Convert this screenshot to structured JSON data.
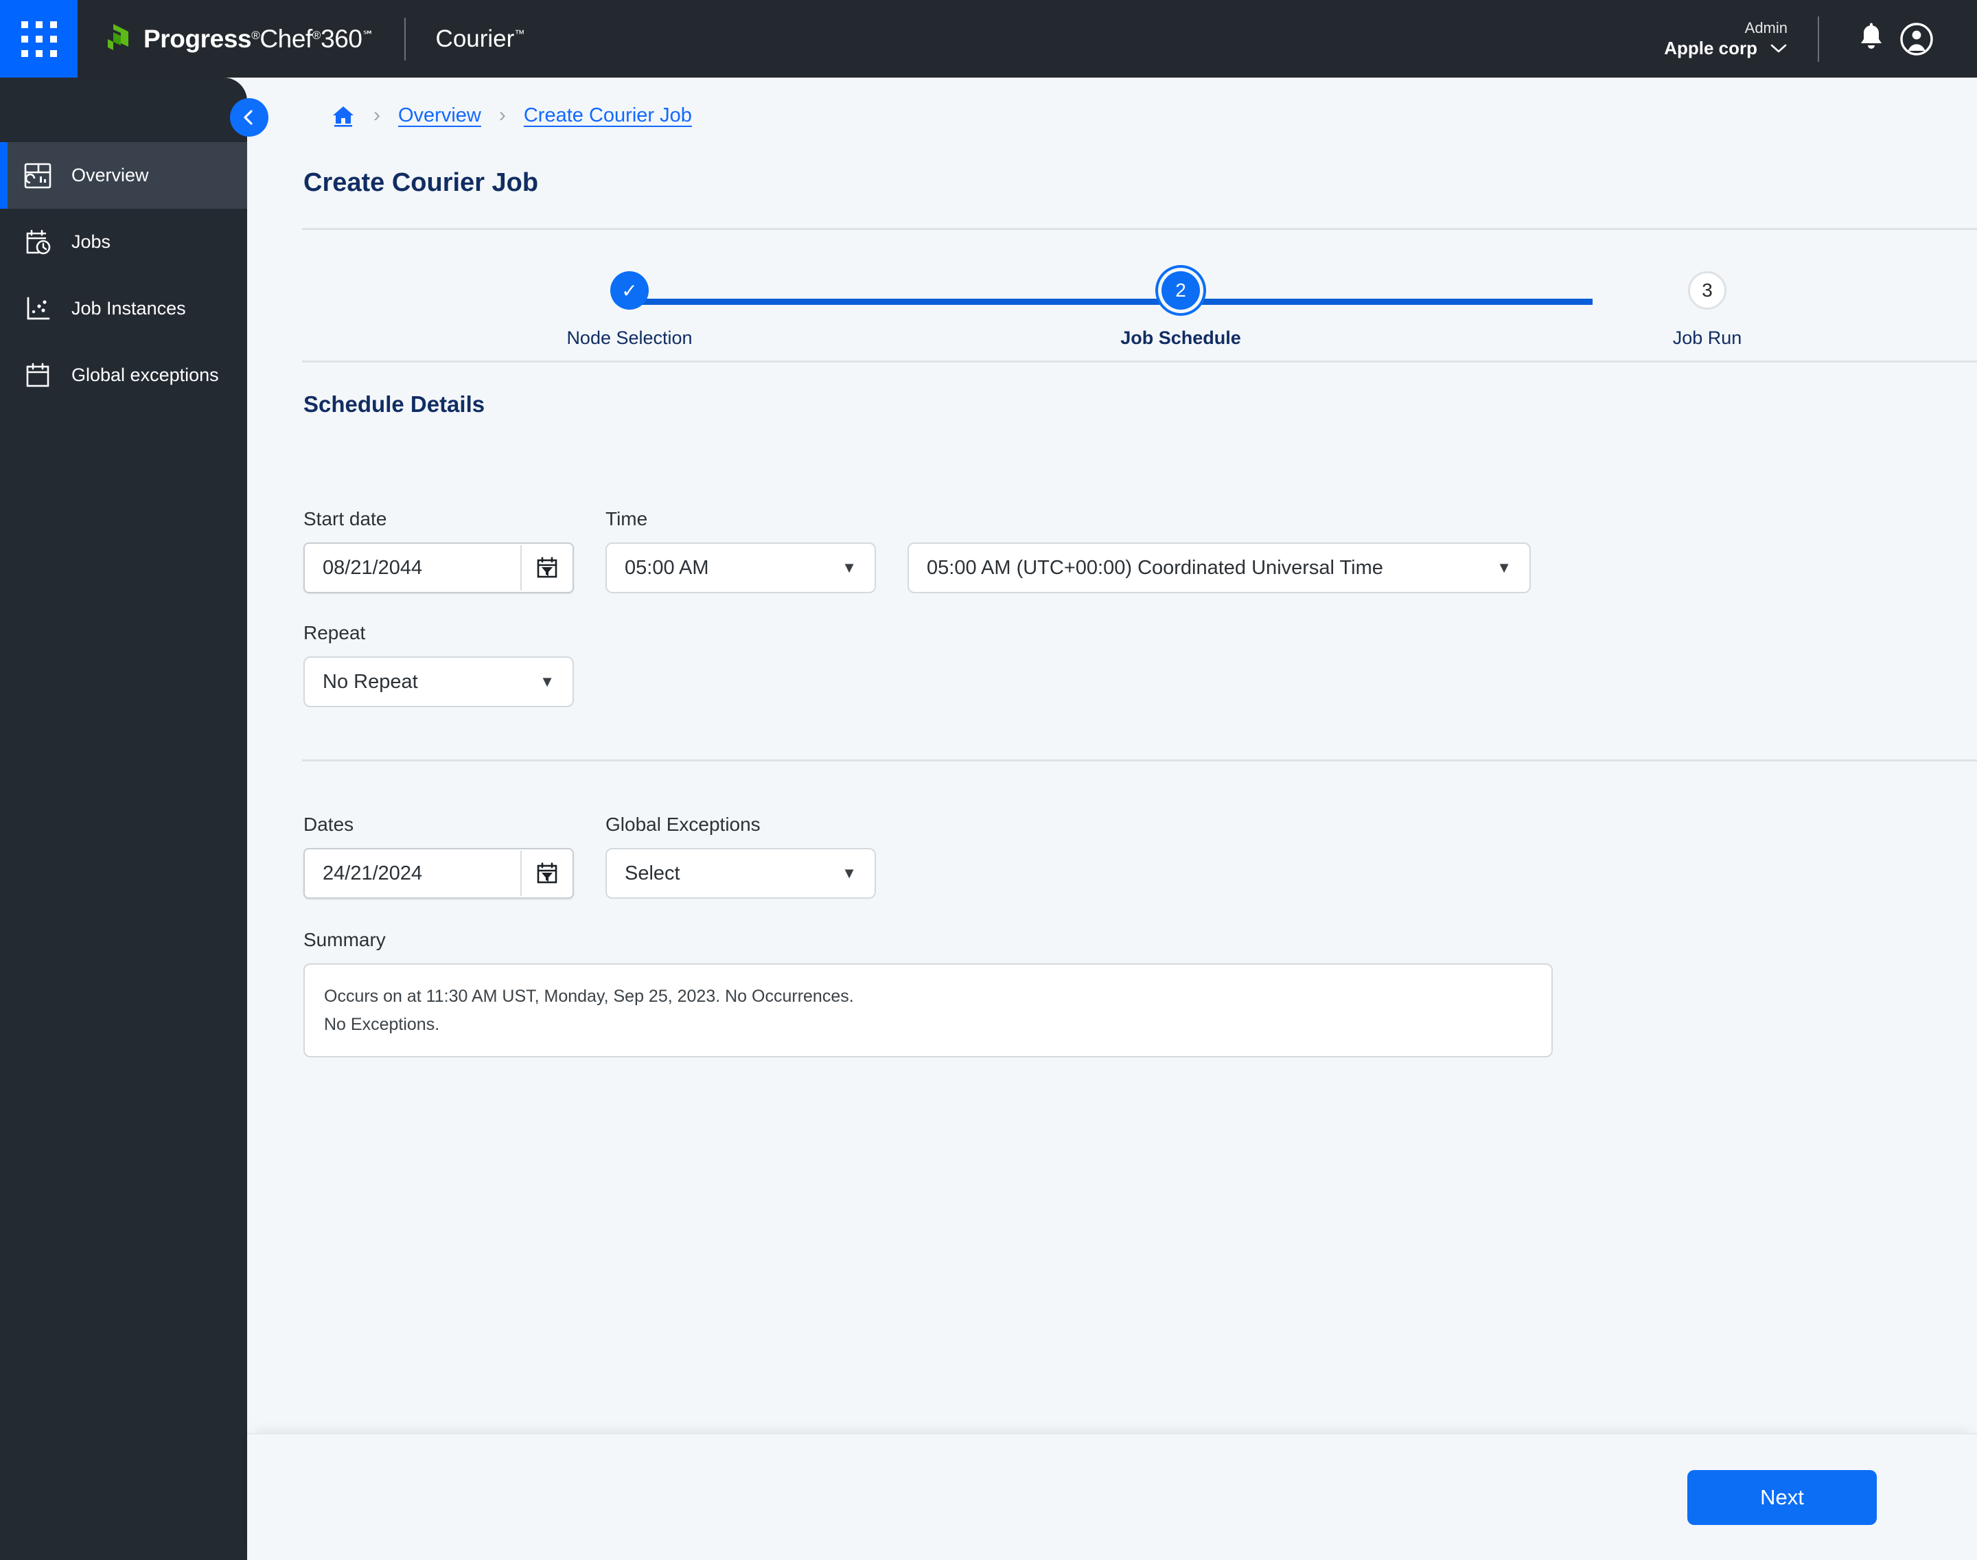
{
  "topbar": {
    "launcher_icon": "apps-grid-icon",
    "brand_progress": "Progress",
    "brand_reg1": "®",
    "brand_chef": "Chef",
    "brand_reg2": "®",
    "brand_360": "360",
    "brand_sm": "℠",
    "product": "Courier",
    "product_tm": "™",
    "role": "Admin",
    "org": "Apple corp",
    "notifications_icon": "bell-icon",
    "account_icon": "user-avatar-icon"
  },
  "sidebar": {
    "items": [
      {
        "label": "Overview",
        "icon": "dashboard-icon",
        "active": true
      },
      {
        "label": "Jobs",
        "icon": "calendar-clock-icon",
        "active": false
      },
      {
        "label": "Job Instances",
        "icon": "scatter-plot-icon",
        "active": false
      },
      {
        "label": "Global exceptions",
        "icon": "calendar-icon",
        "active": false
      }
    ]
  },
  "breadcrumb": {
    "back_icon": "chevron-left-icon",
    "home_icon": "home-icon",
    "separator": "›",
    "items": [
      {
        "label": "Overview"
      },
      {
        "label": "Create Courier Job"
      }
    ]
  },
  "page": {
    "title": "Create Courier Job",
    "section_title": "Schedule Details"
  },
  "stepper": {
    "steps": [
      {
        "marker": "✓",
        "label": "Node Selection",
        "state": "done"
      },
      {
        "marker": "2",
        "label": "Job Schedule",
        "state": "current"
      },
      {
        "marker": "3",
        "label": "Job Run",
        "state": "todo"
      }
    ]
  },
  "form": {
    "start_date": {
      "label": "Start date",
      "value": "08/21/2044",
      "placeholder": "MM/DD/YYYY",
      "icon": "calendar-filter-icon"
    },
    "time": {
      "label": "Time",
      "value": "05:00 AM",
      "caret": "▼"
    },
    "timezone": {
      "value": "05:00 AM (UTC+00:00) Coordinated Universal Time",
      "caret": "▼"
    },
    "repeat": {
      "label": "Repeat",
      "value": "No Repeat",
      "caret": "▼"
    },
    "dates": {
      "label": "Dates",
      "value": "24/21/2024",
      "placeholder": "MM/DD/YYYY",
      "icon": "calendar-filter-icon"
    },
    "global_exceptions": {
      "label": "Global Exceptions",
      "value": "Select",
      "caret": "▼"
    },
    "summary": {
      "label": "Summary",
      "line1": "Occurs on at 11:30 AM UST, Monday, Sep 25, 2023. No Occurrences.",
      "line2": "No Exceptions."
    }
  },
  "footer": {
    "next_label": "Next"
  },
  "colors": {
    "accent_blue": "#0b6ef5",
    "launcher_blue": "#0066ff",
    "topbar_dark": "#24292f",
    "sidebar_dark": "#242a32",
    "sidebar_active": "#39424c",
    "page_bg": "#f3f7fa",
    "title_navy": "#112d62",
    "link_blue": "#1268ff"
  }
}
